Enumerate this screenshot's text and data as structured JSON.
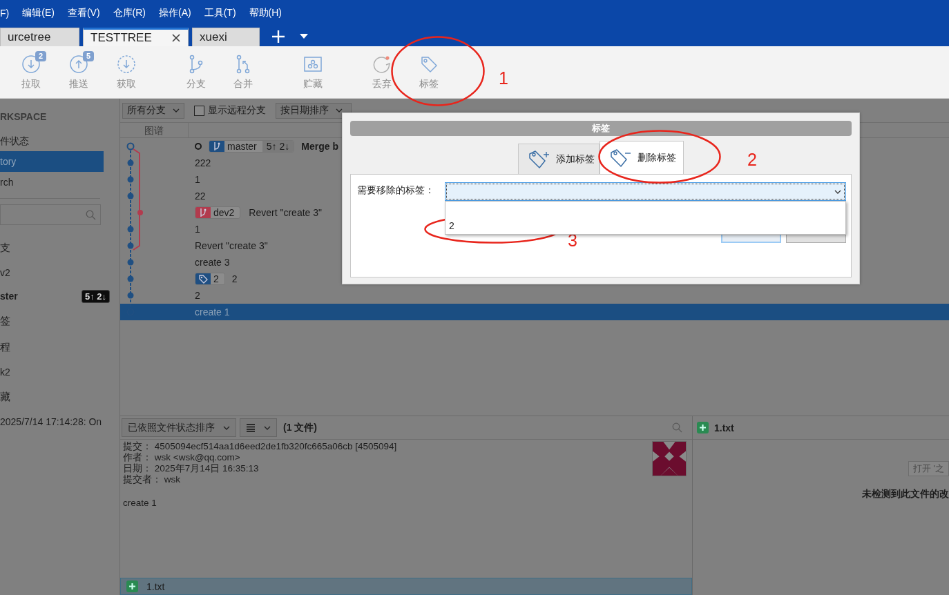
{
  "menu": [
    "F)",
    "编辑(E)",
    "查看(V)",
    "仓库(R)",
    "操作(A)",
    "工具(T)",
    "帮助(H)"
  ],
  "repo_tabs": [
    {
      "label": "urcetree",
      "selected": false
    },
    {
      "label": "TESTTREE",
      "selected": true
    },
    {
      "label": "xuexi",
      "selected": false
    }
  ],
  "toolbar": [
    {
      "kind": "pull",
      "label": "拉取",
      "badge": "2"
    },
    {
      "kind": "push",
      "label": "推送",
      "badge": "5"
    },
    {
      "kind": "fetch",
      "label": "获取"
    },
    {
      "kind": "branch",
      "label": "分支"
    },
    {
      "kind": "merge",
      "label": "合并"
    },
    {
      "kind": "stash",
      "label": "贮藏"
    },
    {
      "kind": "discard",
      "label": "丢弃"
    },
    {
      "kind": "tag",
      "label": "标签"
    }
  ],
  "sidebar": {
    "header": "RKSPACE",
    "items": [
      {
        "label": "件状态",
        "selected": false
      },
      {
        "label": "tory",
        "selected": true
      },
      {
        "label": "rch",
        "selected": false
      }
    ],
    "sections": [
      {
        "kind": "heading",
        "label": "支"
      },
      {
        "kind": "item",
        "label": "v2",
        "current": false
      },
      {
        "kind": "item",
        "label": "ster",
        "current": true,
        "badge": "5↑ 2↓"
      },
      {
        "kind": "heading",
        "label": "签"
      },
      {
        "kind": "heading",
        "label": "程"
      },
      {
        "kind": "item",
        "label": "k2",
        "current": false
      },
      {
        "kind": "heading",
        "label": "藏"
      },
      {
        "kind": "item",
        "label": "2025/7/14 17:14:28: On",
        "current": false
      }
    ]
  },
  "history": {
    "branch_filter": "所有分支",
    "show_remote": {
      "label": "显示远程分支",
      "checked": false
    },
    "sort": "按日期排序",
    "columns": [
      "图谱"
    ],
    "rows": [
      {
        "message": "Merge b",
        "bold": true,
        "head": true,
        "selected": false,
        "refs": [
          {
            "kind": "branch",
            "name": "master",
            "color": "#1f4f82",
            "tracking": "5↑ 2↓"
          }
        ]
      },
      {
        "message": "222",
        "bold": false,
        "head": false,
        "selected": false
      },
      {
        "message": "1",
        "bold": false,
        "head": false,
        "selected": false
      },
      {
        "message": "22",
        "bold": false,
        "head": false,
        "selected": false
      },
      {
        "message": "Revert \"create 3\"",
        "bold": false,
        "head": false,
        "selected": false,
        "refs": [
          {
            "kind": "branch",
            "name": "dev2",
            "color": "#b23b4e"
          }
        ]
      },
      {
        "message": "1",
        "bold": false,
        "head": false,
        "selected": false
      },
      {
        "message": "Revert \"create 3\"",
        "bold": false,
        "head": false,
        "selected": false
      },
      {
        "message": "create 3",
        "bold": false,
        "head": false,
        "selected": false
      },
      {
        "message": "2",
        "bold": false,
        "head": false,
        "selected": false,
        "refs": [
          {
            "kind": "tag",
            "name": "2",
            "color": "#1f4f82"
          }
        ]
      },
      {
        "message": "2",
        "bold": false,
        "head": false,
        "selected": false
      },
      {
        "message": "create 1",
        "bold": false,
        "head": false,
        "selected": true
      }
    ]
  },
  "details": {
    "sort": "已依照文件状态排序",
    "file_count": "(1 文件)",
    "lines": [
      {
        "label": "提交：",
        "value": "4505094ecf514aa1d6eed2de1fb320fc665a06cb [4505094]"
      },
      {
        "label": "作者：",
        "value": "wsk <wsk@qq.com>"
      },
      {
        "label": "日期：",
        "value": "2025年7月14日 16:35:13"
      },
      {
        "label": "提交者：",
        "value": "wsk"
      }
    ],
    "message": "create 1",
    "files": [
      {
        "name": "1.txt",
        "kind": "added",
        "selected": true
      }
    ]
  },
  "diff": {
    "file": "1.txt",
    "kind": "added",
    "open_button": "打开 '之",
    "message": "未检测到此文件的改"
  },
  "tag_dialog": {
    "title": "标签",
    "tabs": [
      {
        "kind": "add",
        "label": "添加标签",
        "selected": false
      },
      {
        "kind": "remove",
        "label": "删除标签",
        "selected": true
      }
    ],
    "field_label": "需要移除的标签：",
    "dropdown": {
      "expanded": true,
      "options": [
        {
          "label": "2",
          "selected": false
        }
      ]
    }
  },
  "annotations": [
    {
      "label": "1"
    },
    {
      "label": "2"
    },
    {
      "label": "3"
    }
  ]
}
